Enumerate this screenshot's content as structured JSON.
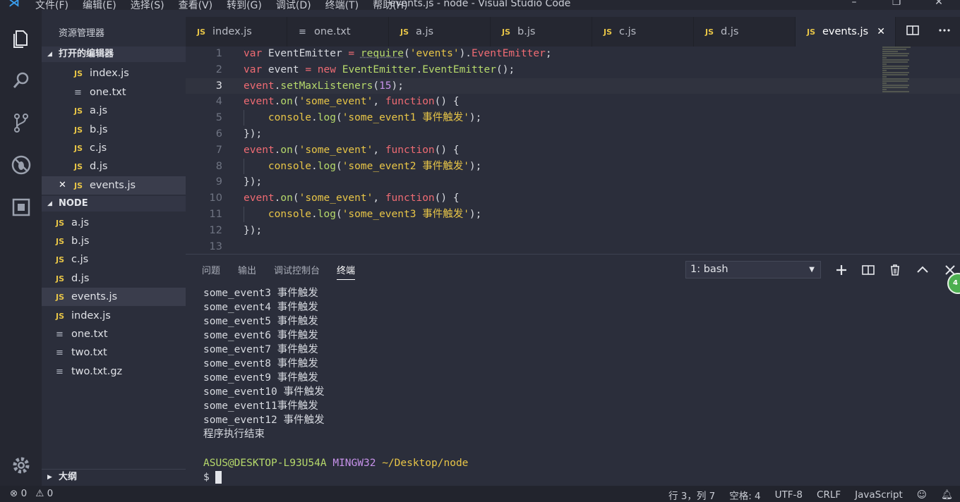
{
  "window": {
    "title": "events.js - node - Visual Studio Code",
    "menu": [
      "文件(F)",
      "编辑(E)",
      "选择(S)",
      "查看(V)",
      "转到(G)",
      "调试(D)",
      "终端(T)",
      "帮助(H)"
    ]
  },
  "sidebar": {
    "title": "资源管理器",
    "open_editors_label": "打开的编辑器",
    "open_editors": [
      {
        "name": "index.js",
        "type": "js"
      },
      {
        "name": "one.txt",
        "type": "txt"
      },
      {
        "name": "a.js",
        "type": "js"
      },
      {
        "name": "b.js",
        "type": "js"
      },
      {
        "name": "c.js",
        "type": "js"
      },
      {
        "name": "d.js",
        "type": "js"
      },
      {
        "name": "events.js",
        "type": "js"
      }
    ],
    "folder_label": "NODE",
    "files": [
      {
        "name": "a.js",
        "type": "js"
      },
      {
        "name": "b.js",
        "type": "js"
      },
      {
        "name": "c.js",
        "type": "js"
      },
      {
        "name": "d.js",
        "type": "js"
      },
      {
        "name": "events.js",
        "type": "js"
      },
      {
        "name": "index.js",
        "type": "js"
      },
      {
        "name": "one.txt",
        "type": "txt"
      },
      {
        "name": "two.txt",
        "type": "txt"
      },
      {
        "name": "two.txt.gz",
        "type": "txt"
      }
    ],
    "outline_label": "大纲"
  },
  "tabs": [
    {
      "label": "index.js",
      "type": "js"
    },
    {
      "label": "one.txt",
      "type": "txt"
    },
    {
      "label": "a.js",
      "type": "js"
    },
    {
      "label": "b.js",
      "type": "js"
    },
    {
      "label": "c.js",
      "type": "js"
    },
    {
      "label": "d.js",
      "type": "js"
    },
    {
      "label": "events.js",
      "type": "js",
      "active": true
    }
  ],
  "editor": {
    "line_numbers": [
      "1",
      "2",
      "3",
      "4",
      "5",
      "6",
      "7",
      "8",
      "9",
      "10",
      "11",
      "12",
      "13"
    ],
    "current_line": 3
  },
  "panel": {
    "tabs": [
      "问题",
      "输出",
      "调试控制台",
      "终端"
    ],
    "active_tab": "终端",
    "terminal_select": "1: bash",
    "terminal_output": [
      "some_event3 事件触发",
      "some_event4 事件触发",
      "some_event5 事件触发",
      "some_event6 事件触发",
      "some_event7 事件触发",
      "some_event8 事件触发",
      "some_event9 事件触发",
      "some_event10 事件触发",
      "some_event11事件触发",
      "some_event12 事件触发",
      "程序执行结束"
    ],
    "prompt_user": "ASUS@DESKTOP-L93U54A",
    "prompt_host": "MINGW32",
    "prompt_path": "~/Desktop/node",
    "prompt_symbol": "$",
    "badge": "4"
  },
  "statusbar": {
    "errors": "0",
    "warnings": "0",
    "position": "行 3，列 7",
    "spaces": "空格: 4",
    "encoding": "UTF-8",
    "eol": "CRLF",
    "language": "JavaScript"
  },
  "colors": {
    "keyword": "#ef6b73",
    "function": "#b6d96b",
    "string": "#e8c547",
    "number": "#c792ea",
    "accent": "#3aa0f2"
  }
}
